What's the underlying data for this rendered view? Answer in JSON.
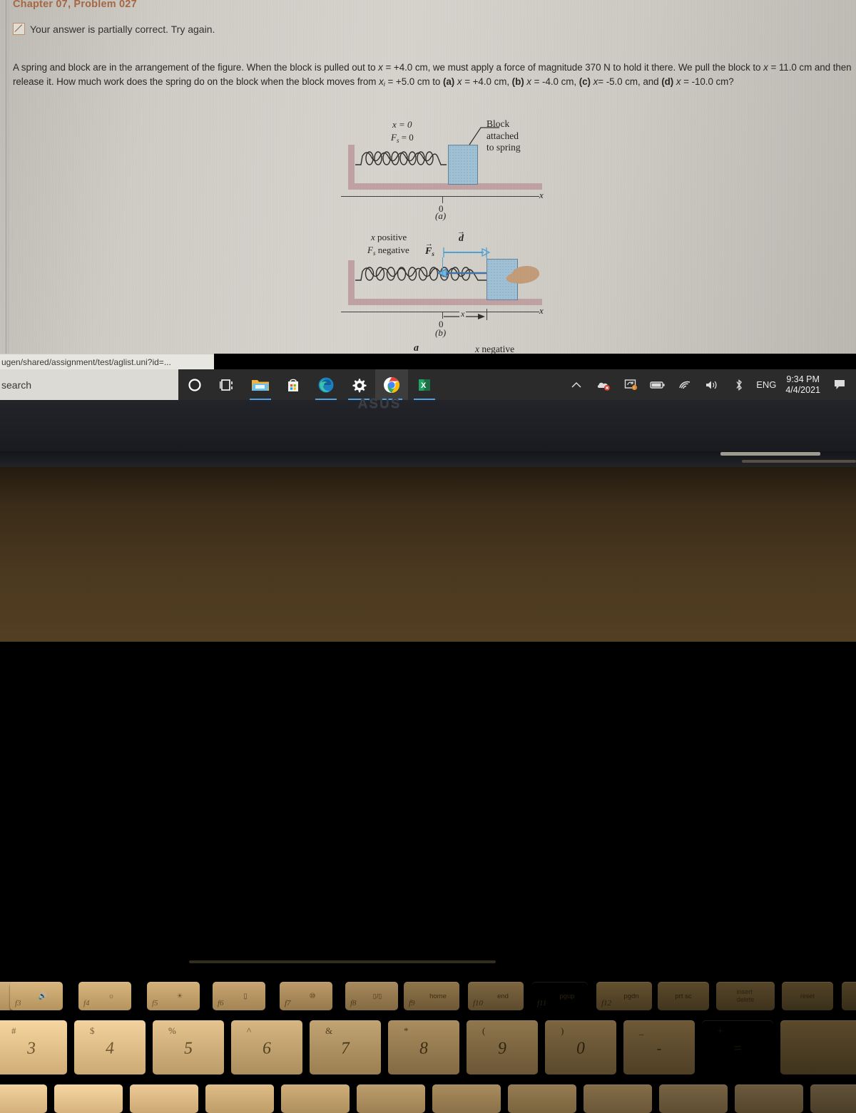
{
  "browser": {
    "url_fragment": "ugen/shared/assignment/test/aglist.uni?id=..."
  },
  "page": {
    "chapter_title": "Chapter 07, Problem 027",
    "status_icon": "partial-check-icon",
    "status_message": "Your answer is partially correct.  Try again.",
    "problem_lines": [
      "A spring and block are in the arrangement of the figure. When the block is pulled out to x = +4.0 cm, we must apply a force of magnitude 370 N to hold it there. We pull",
      "the block to x = 11.0 cm and then release it. How much work does the spring do on the block when the block moves from x",
      " = +5.0 cm to (a) x = +4.0 cm, (b) x = -4.0",
      "cm, (c) x= -5.0 cm, and (d) x = -10.0 cm?"
    ],
    "problem_values": {
      "applied_force_N": 370,
      "hold_position_cm": 4.0,
      "pull_position_cm": 11.0,
      "initial_position_cm": 5.0,
      "a_cm": 4.0,
      "b_cm": -4.0,
      "c_cm": -5.0,
      "d_cm": -10.0
    }
  },
  "figure": {
    "panel_a": {
      "caption": "(a)",
      "label_x": "x = 0",
      "label_f": "F",
      "label_f_sub": "s",
      "label_f_rest": " = 0",
      "annotation": [
        "Block",
        "attached",
        "to spring"
      ],
      "axis_label": "x",
      "origin_label": "0"
    },
    "panel_b": {
      "caption": "(b)",
      "line1": "x positive",
      "line2_a": "F",
      "line2_sub": "s",
      "line2_b": " negative",
      "vector_d": "d",
      "vector_f": "F",
      "vector_f_sub": "s",
      "axis_label": "x",
      "origin_label": "0",
      "distance_label": "x"
    },
    "panel_c": {
      "vector_d": "d",
      "label": "x negative"
    }
  },
  "taskbar": {
    "search_placeholder": "search",
    "items": [
      {
        "name": "cortana-icon",
        "label": "Cortana"
      },
      {
        "name": "task-view-icon",
        "label": "Task View"
      },
      {
        "name": "file-explorer-icon",
        "label": "File Explorer"
      },
      {
        "name": "microsoft-store-icon",
        "label": "Microsoft Store"
      },
      {
        "name": "edge-icon",
        "label": "Microsoft Edge"
      },
      {
        "name": "settings-gear-icon",
        "label": "Settings"
      },
      {
        "name": "chrome-icon",
        "label": "Google Chrome"
      },
      {
        "name": "excel-icon",
        "label": "Excel"
      }
    ],
    "tray": {
      "show_hidden": "^",
      "icons": [
        "onedrive-error-icon",
        "sync-warning-icon",
        "battery-icon",
        "wifi-icon",
        "volume-icon",
        "bluetooth-icon"
      ],
      "language": "ENG",
      "time": "9:34 PM",
      "date": "4/4/2021",
      "action_center": "notification-icon"
    }
  },
  "laptop": {
    "brand": "ASUS",
    "function_keys": [
      {
        "key": "f3",
        "glyph": "volume-up-icon"
      },
      {
        "key": "f4",
        "glyph": "brightness-down-icon"
      },
      {
        "key": "f5",
        "glyph": "brightness-up-icon"
      },
      {
        "key": "f6",
        "glyph": "display-off-icon"
      },
      {
        "key": "f7",
        "glyph": "keyboard-backlight-icon"
      },
      {
        "key": "f8",
        "glyph": "display-switch-icon"
      },
      {
        "key": "f9",
        "glyph": "home"
      },
      {
        "key": "f10",
        "glyph": "end"
      },
      {
        "key": "f11",
        "glyph": "pgup"
      },
      {
        "key": "f12",
        "glyph": "pgdn"
      },
      {
        "key": "prt sc",
        "glyph": ""
      },
      {
        "key": "insert",
        "glyph": "delete"
      },
      {
        "key": "reset",
        "glyph": ""
      }
    ],
    "number_keys": [
      {
        "num": "3",
        "sym": "#"
      },
      {
        "num": "4",
        "sym": "$"
      },
      {
        "num": "5",
        "sym": "%"
      },
      {
        "num": "6",
        "sym": "^"
      },
      {
        "num": "7",
        "sym": "&"
      },
      {
        "num": "8",
        "sym": "*"
      },
      {
        "num": "9",
        "sym": "("
      },
      {
        "num": "0",
        "sym": ")"
      },
      {
        "num": "-",
        "sym": "_"
      },
      {
        "num": "=",
        "sym": "+"
      }
    ]
  },
  "colors": {
    "accent_title": "#a5643f",
    "taskbar_bg": "#2b2b2b",
    "screen_bg": "#cdcac3",
    "block_fill": "#9fc0d6",
    "wall_fill": "#c0a0a0",
    "vector_blue": "#4a9fd4"
  }
}
